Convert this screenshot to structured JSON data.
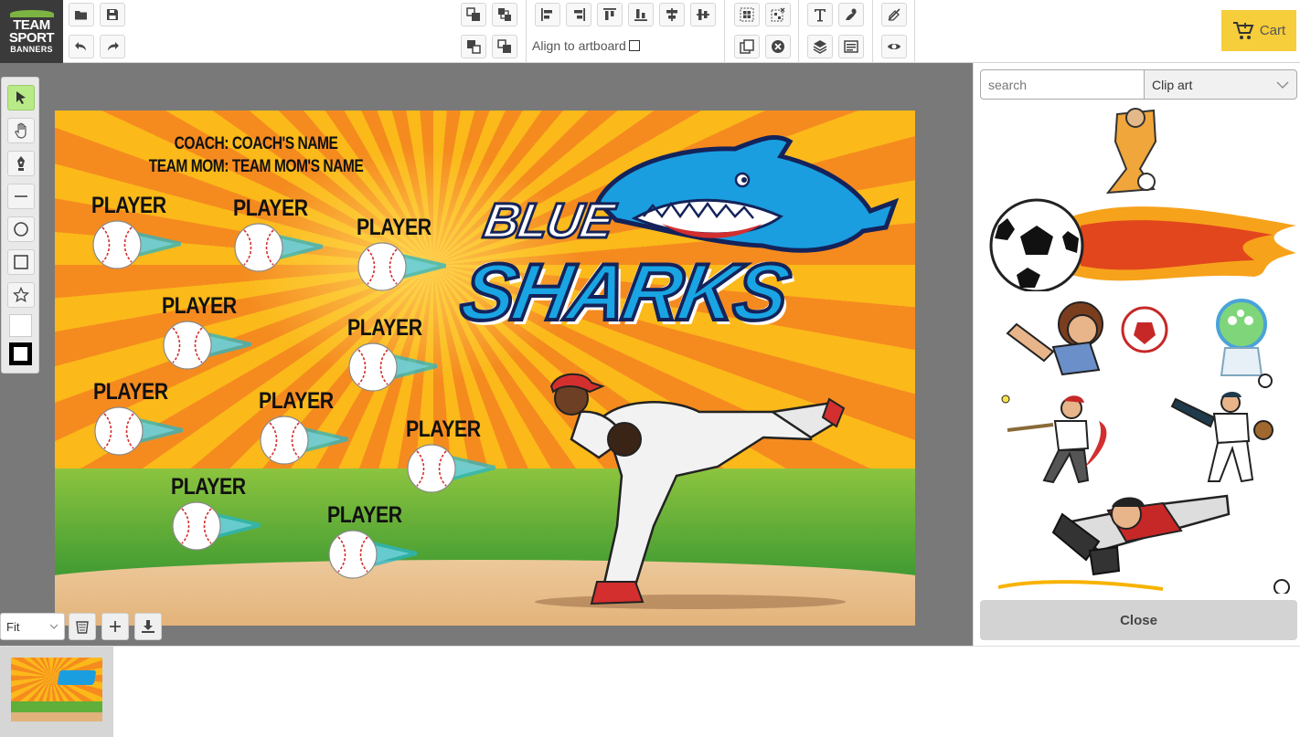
{
  "app": {
    "logo": {
      "line1": "TEAM",
      "line2": "SPORT",
      "line3": "BANNERS"
    }
  },
  "toolbar": {
    "align_to_artboard_label": "Align to artboard",
    "align_to_artboard_checked": false,
    "cart_label": "Cart",
    "buttons": [
      "open-icon",
      "save-icon",
      "undo-icon",
      "redo-icon",
      "bring-forward-icon",
      "bring-to-front-icon",
      "send-backward-icon",
      "send-to-back-icon",
      "align-left-icon",
      "align-right-icon",
      "align-top-icon",
      "align-bottom-icon",
      "align-center-vertical-icon",
      "align-center-horizontal-icon",
      "group-icon",
      "ungroup-icon",
      "duplicate-icon",
      "delete-icon",
      "text-icon",
      "clipart-icon",
      "layers-icon",
      "properties-icon",
      "no-fill-icon",
      "preview-icon"
    ]
  },
  "left_tools": [
    "select-tool",
    "pan-tool",
    "pen-tool",
    "line-tool",
    "circle-tool",
    "rectangle-tool",
    "star-tool",
    "fill-color-swatch",
    "stroke-color-swatch"
  ],
  "colors": {
    "accent_green": "#b9ea88",
    "cart_yellow": "#f6cd3b",
    "workspace_gray": "#797979",
    "fill_color": "#ffffff",
    "stroke_color": "#000000"
  },
  "banner": {
    "coach_line": "COACH: COACH'S NAME",
    "team_mom_line": "TEAM MOM: TEAM MOM'S NAME",
    "team_name_top": "BLUE",
    "team_name_bottom": "SHARKS",
    "player_label": "PLAYER",
    "players": [
      {
        "label": "PLAYER"
      },
      {
        "label": "PLAYER"
      },
      {
        "label": "PLAYER"
      },
      {
        "label": "PLAYER"
      },
      {
        "label": "PLAYER"
      },
      {
        "label": "PLAYER"
      },
      {
        "label": "PLAYER"
      },
      {
        "label": "PLAYER"
      },
      {
        "label": "PLAYER"
      },
      {
        "label": "PLAYER"
      },
      {
        "label": "PLAYER"
      }
    ]
  },
  "zoom": {
    "value": "Fit"
  },
  "bottom_buttons": [
    "trash-icon",
    "add-page-icon",
    "download-icon"
  ],
  "right_panel": {
    "search_placeholder": "search",
    "category_value": "Clip art",
    "close_label": "Close",
    "clipart_items": [
      "soccer-player-clipart",
      "flaming-soccer-ball-clipart",
      "kid-kicking-soccer-clipart",
      "alien-soccer-clipart",
      "softball-batter-clipart",
      "baseball-pitcher-clipart",
      "sliding-baseball-player-clipart"
    ]
  }
}
